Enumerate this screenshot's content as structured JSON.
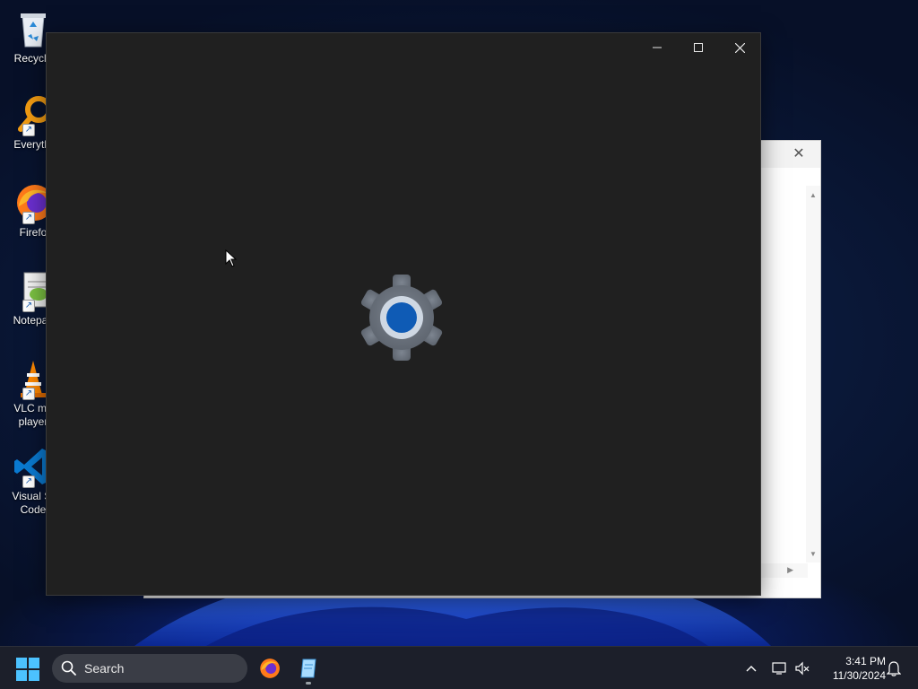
{
  "desktop": {
    "icons": [
      {
        "label": "Recycle",
        "icon": "recycle-bin-icon"
      },
      {
        "label": "Everythi",
        "icon": "everything-search-icon"
      },
      {
        "label": "Firefo",
        "icon": "firefox-icon"
      },
      {
        "label": "Notepac",
        "icon": "notepad-plus-plus-icon"
      },
      {
        "label": "VLC me\nplayer",
        "icon": "vlc-icon"
      },
      {
        "label": "Visual St\nCode",
        "icon": "vscode-icon"
      }
    ]
  },
  "settings_window": {
    "minimize_glyph": "—",
    "maximize_glyph": "☐",
    "close_glyph": "✕",
    "splash_icon": "settings-gear-icon",
    "accent_color": "#0f5bb5"
  },
  "background_window": {
    "close_glyph": "✕"
  },
  "taskbar": {
    "search_label": "Search",
    "time": "3:41 PM",
    "date": "11/30/2024",
    "pinned": [
      "firefox-icon",
      "notepad-icon"
    ],
    "tray_icons": [
      "chevron-up-icon",
      "network-icon",
      "volume-muted-icon",
      "notification-bell-icon"
    ]
  }
}
